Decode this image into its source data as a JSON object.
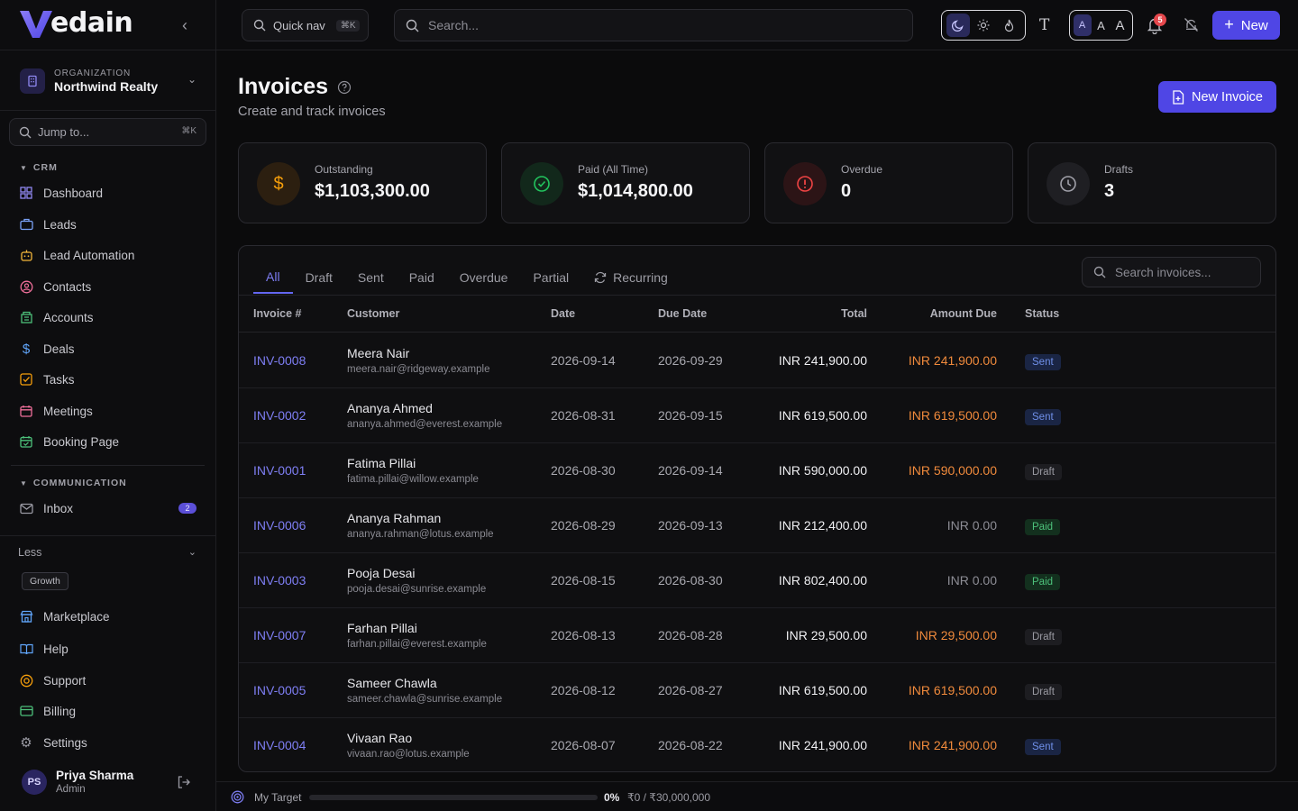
{
  "brand": {
    "name": "edain",
    "accent": "#4f46e5"
  },
  "sidebar": {
    "org_label": "ORGANIZATION",
    "org_name": "Northwind Realty",
    "jump_placeholder": "Jump to...",
    "jump_shortcut": "⌘K",
    "sections": [
      {
        "title": "CRM"
      },
      {
        "title": "COMMUNICATION"
      }
    ],
    "crm_items": [
      {
        "label": "Dashboard",
        "icon": "grid-icon"
      },
      {
        "label": "Leads",
        "icon": "briefcase-icon"
      },
      {
        "label": "Lead Automation",
        "icon": "bot-icon"
      },
      {
        "label": "Contacts",
        "icon": "contact-icon"
      },
      {
        "label": "Accounts",
        "icon": "building-icon"
      },
      {
        "label": "Deals",
        "icon": "dollar-icon"
      },
      {
        "label": "Tasks",
        "icon": "checkbox-icon"
      },
      {
        "label": "Meetings",
        "icon": "calendar-icon"
      },
      {
        "label": "Booking Page",
        "icon": "calendar-check-icon"
      }
    ],
    "comm_items": [
      {
        "label": "Inbox",
        "icon": "mail-icon",
        "badge": "2"
      }
    ],
    "less_label": "Less",
    "plan_badge": "Growth",
    "bottom_items": [
      {
        "label": "Marketplace",
        "icon": "store-icon"
      },
      {
        "label": "Help",
        "icon": "book-icon"
      },
      {
        "label": "Support",
        "icon": "lifebuoy-icon"
      },
      {
        "label": "Billing",
        "icon": "card-icon"
      },
      {
        "label": "Settings",
        "icon": "gear-icon"
      }
    ],
    "user": {
      "initials": "PS",
      "name": "Priya Sharma",
      "role": "Admin"
    }
  },
  "topbar": {
    "quicknav_label": "Quick nav",
    "quicknav_shortcut": "⌘K",
    "search_placeholder": "Search...",
    "font_size_options": [
      "A",
      "A",
      "A"
    ],
    "notification_count": "5",
    "new_label": "New"
  },
  "page": {
    "title": "Invoices",
    "subtitle": "Create and track invoices",
    "new_invoice_label": "New Invoice"
  },
  "stats": [
    {
      "label": "Outstanding",
      "value": "$1,103,300.00",
      "icon": "dollar-icon",
      "color": "#f59e0b"
    },
    {
      "label": "Paid (All Time)",
      "value": "$1,014,800.00",
      "icon": "check-circle-icon",
      "color": "#22c55e"
    },
    {
      "label": "Overdue",
      "value": "0",
      "icon": "alert-circle-icon",
      "color": "#ef4444"
    },
    {
      "label": "Drafts",
      "value": "3",
      "icon": "clock-icon",
      "color": "#a1a1aa"
    }
  ],
  "tabs": [
    "All",
    "Draft",
    "Sent",
    "Paid",
    "Overdue",
    "Partial",
    "Recurring"
  ],
  "invoice_search_placeholder": "Search invoices...",
  "columns": [
    "Invoice #",
    "Customer",
    "Date",
    "Due Date",
    "Total",
    "Amount Due",
    "Status"
  ],
  "invoices": [
    {
      "number": "INV-0008",
      "name": "Meera Nair",
      "email": "meera.nair@ridgeway.example",
      "date": "2026-09-14",
      "due": "2026-09-29",
      "total": "INR 241,900.00",
      "amount_due": "INR 241,900.00",
      "status": "Sent"
    },
    {
      "number": "INV-0002",
      "name": "Ananya Ahmed",
      "email": "ananya.ahmed@everest.example",
      "date": "2026-08-31",
      "due": "2026-09-15",
      "total": "INR 619,500.00",
      "amount_due": "INR 619,500.00",
      "status": "Sent"
    },
    {
      "number": "INV-0001",
      "name": "Fatima Pillai",
      "email": "fatima.pillai@willow.example",
      "date": "2026-08-30",
      "due": "2026-09-14",
      "total": "INR 590,000.00",
      "amount_due": "INR 590,000.00",
      "status": "Draft"
    },
    {
      "number": "INV-0006",
      "name": "Ananya Rahman",
      "email": "ananya.rahman@lotus.example",
      "date": "2026-08-29",
      "due": "2026-09-13",
      "total": "INR 212,400.00",
      "amount_due": "INR 0.00",
      "status": "Paid"
    },
    {
      "number": "INV-0003",
      "name": "Pooja Desai",
      "email": "pooja.desai@sunrise.example",
      "date": "2026-08-15",
      "due": "2026-08-30",
      "total": "INR 802,400.00",
      "amount_due": "INR 0.00",
      "status": "Paid"
    },
    {
      "number": "INV-0007",
      "name": "Farhan Pillai",
      "email": "farhan.pillai@everest.example",
      "date": "2026-08-13",
      "due": "2026-08-28",
      "total": "INR 29,500.00",
      "amount_due": "INR 29,500.00",
      "status": "Draft"
    },
    {
      "number": "INV-0005",
      "name": "Sameer Chawla",
      "email": "sameer.chawla@sunrise.example",
      "date": "2026-08-12",
      "due": "2026-08-27",
      "total": "INR 619,500.00",
      "amount_due": "INR 619,500.00",
      "status": "Draft"
    },
    {
      "number": "INV-0004",
      "name": "Vivaan Rao",
      "email": "vivaan.rao@lotus.example",
      "date": "2026-08-07",
      "due": "2026-08-22",
      "total": "INR 241,900.00",
      "amount_due": "INR 241,900.00",
      "status": "Sent"
    }
  ],
  "footer": {
    "target_label": "My Target",
    "target_percent": "0%",
    "target_progress": 0,
    "target_amount": "₹0 / ₹30,000,000"
  }
}
